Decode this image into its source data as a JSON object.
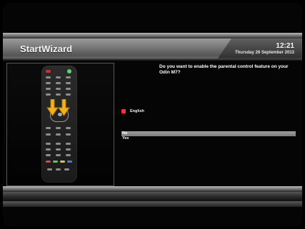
{
  "header": {
    "title": "StartWizard",
    "time": "12:21",
    "date": "Thursday 26 September 2013"
  },
  "content": {
    "question": "Do you want to enable the parental control feature on your Odin M7?",
    "language": "English",
    "options": [
      {
        "label": "No",
        "selected": true
      },
      {
        "label": "Yes",
        "selected": false
      }
    ]
  },
  "icons": {
    "remote": "remote-control-icon",
    "arrow": "down-arrow-icon",
    "language_marker": "red-square-icon"
  },
  "colors": {
    "accent_red": "#ff2d2d",
    "highlight": "#8d8d8d",
    "arrow_yellow": "#f0b11b"
  }
}
